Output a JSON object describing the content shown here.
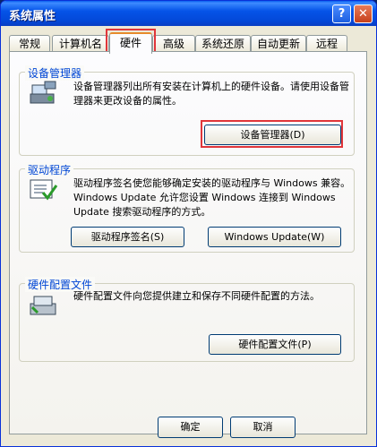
{
  "window": {
    "title": "系统属性",
    "help_glyph": "?",
    "close_glyph": "✕"
  },
  "tabs": [
    {
      "label": "常规"
    },
    {
      "label": "计算机名"
    },
    {
      "label": "硬件"
    },
    {
      "label": "高级"
    },
    {
      "label": "系统还原"
    },
    {
      "label": "自动更新"
    },
    {
      "label": "远程"
    }
  ],
  "device_manager": {
    "legend": "设备管理器",
    "description": "设备管理器列出所有安装在计算机上的硬件设备。请使用设备管理器来更改设备的属性。",
    "button": "设备管理器(D)"
  },
  "drivers": {
    "legend": "驱动程序",
    "description": "驱动程序签名使您能够确定安装的驱动程序与 Windows 兼容。Windows Update 允许您设置 Windows 连接到 Windows Update 搜索驱动程序的方式。",
    "sign_button": "驱动程序签名(S)",
    "update_button": "Windows Update(W)"
  },
  "hardware_profiles": {
    "legend": "硬件配置文件",
    "description": "硬件配置文件向您提供建立和保存不同硬件配置的方法。",
    "button": "硬件配置文件(P)"
  },
  "footer": {
    "ok": "确定",
    "cancel": "取消"
  }
}
